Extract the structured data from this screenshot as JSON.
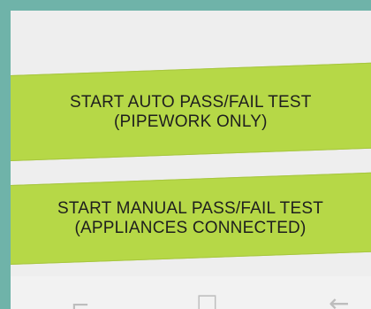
{
  "buttons": {
    "auto": {
      "line1": "START AUTO PASS/FAIL TEST",
      "line2": "(PIPEWORK ONLY)"
    },
    "manual": {
      "line1": "START MANUAL PASS/FAIL TEST",
      "line2": "(APPLIANCES CONNECTED)"
    }
  },
  "colors": {
    "border": "#6fb3a9",
    "button": "#b6d847",
    "background": "#eeeeee"
  },
  "navbar": {
    "recents_icon": "recents-icon",
    "home_icon": "home-icon",
    "back_icon": "back-icon"
  }
}
